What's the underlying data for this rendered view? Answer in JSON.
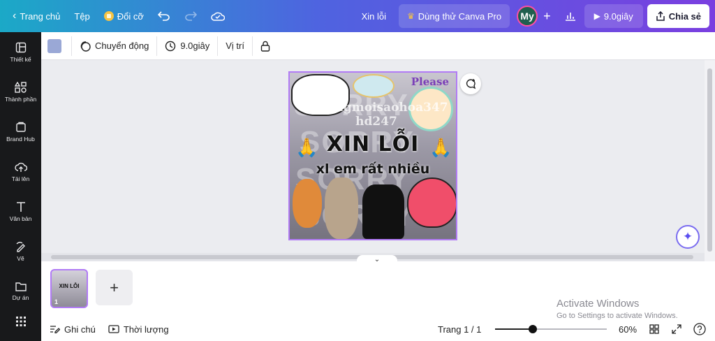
{
  "header": {
    "back_label": "Trang chủ",
    "file_label": "Tệp",
    "resize_label": "Đổi cỡ",
    "doc_title": "Xin lỗi",
    "trial_label": "Dùng thử Canva Pro",
    "avatar_initials": "My",
    "play_label": "9.0giây",
    "share_label": "Chia sẻ"
  },
  "sidebar": {
    "items": [
      {
        "label": "Thiết kế",
        "icon": "layout-icon"
      },
      {
        "label": "Thành phần",
        "icon": "elements-icon"
      },
      {
        "label": "Brand Hub",
        "icon": "brand-icon"
      },
      {
        "label": "Tải lên",
        "icon": "upload-cloud-icon"
      },
      {
        "label": "Văn bản",
        "icon": "text-icon"
      },
      {
        "label": "Vẽ",
        "icon": "draw-icon"
      },
      {
        "label": "Dự án",
        "icon": "folder-icon"
      }
    ]
  },
  "toolbar": {
    "color": "#9aa8d6",
    "animate_label": "Chuyển động",
    "duration_label": "9.0giây",
    "position_label": "Vị trí"
  },
  "design": {
    "watermark": "@Dongmoisaohoa347 hd247",
    "title": "XIN LỖI",
    "subtitle": "xl em rất nhiều",
    "sticker_text": "Please",
    "background_words": [
      "SORRY",
      "SORRY",
      "SORRY",
      "SORRY"
    ]
  },
  "pages": {
    "thumb_title": "XIN LỖI",
    "thumb_number": "1"
  },
  "footer": {
    "notes_label": "Ghi chú",
    "duration_label": "Thời lượng",
    "page_label": "Trang 1 / 1",
    "zoom_label": "60%",
    "zoom_value": 0.6
  },
  "os_overlay": {
    "title": "Activate Windows",
    "subtitle": "Go to Settings to activate Windows."
  },
  "colors": {
    "accent": "#7a3fe0",
    "selection": "#b17bf5"
  }
}
